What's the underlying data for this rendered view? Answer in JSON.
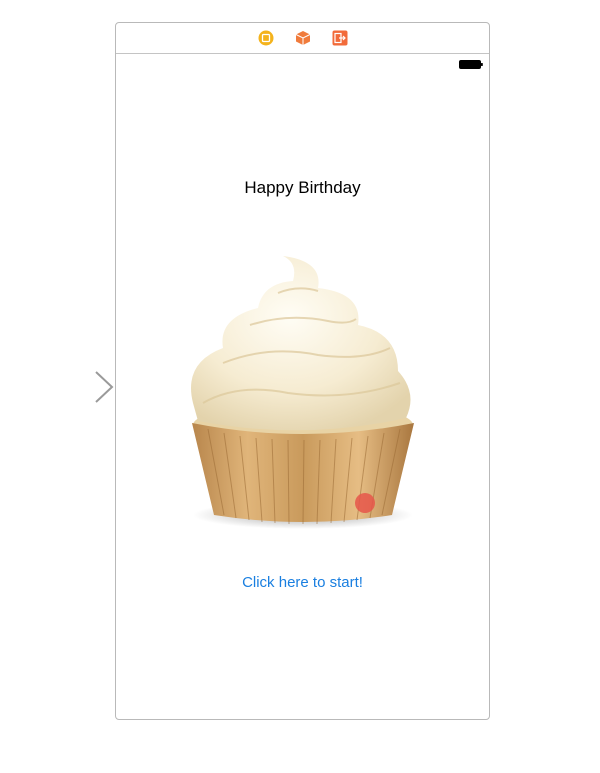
{
  "scene": {
    "title_text": "Happy Birthday",
    "button_text": "Click here to start!",
    "image_name": "cupcake-image",
    "icons": [
      "view-controller-icon",
      "first-responder-icon",
      "exit-icon",
      "battery-icon",
      "entry-point-arrow-icon"
    ]
  },
  "colors": {
    "link": "#1a7fe0",
    "vc_icon": "#f4b31c",
    "responder_icon": "#f07b3c",
    "exit_icon": "#f26b3a",
    "frame_border": "#b9b9b9"
  }
}
